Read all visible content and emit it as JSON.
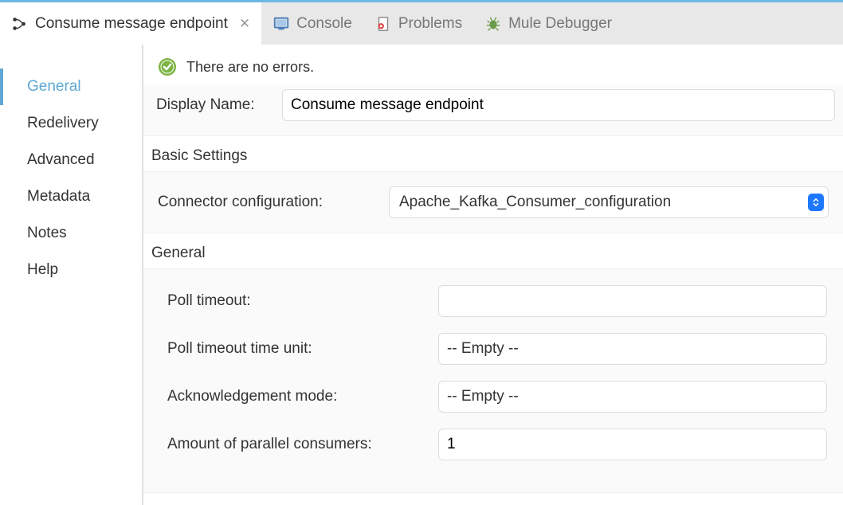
{
  "tabs": [
    {
      "label": "Consume message endpoint",
      "icon": "flow-icon",
      "active": true,
      "closable": true
    },
    {
      "label": "Console",
      "icon": "console-icon",
      "active": false,
      "closable": false
    },
    {
      "label": "Problems",
      "icon": "problems-icon",
      "active": false,
      "closable": false
    },
    {
      "label": "Mule Debugger",
      "icon": "debugger-icon",
      "active": false,
      "closable": false
    }
  ],
  "sidebar": {
    "items": [
      {
        "label": "General",
        "active": true
      },
      {
        "label": "Redelivery",
        "active": false
      },
      {
        "label": "Advanced",
        "active": false
      },
      {
        "label": "Metadata",
        "active": false
      },
      {
        "label": "Notes",
        "active": false
      },
      {
        "label": "Help",
        "active": false
      }
    ]
  },
  "status": {
    "message": "There are no errors."
  },
  "display_name": {
    "label": "Display Name:",
    "value": "Consume message endpoint"
  },
  "sections": {
    "basic": {
      "title": "Basic Settings",
      "connector_label": "Connector configuration:",
      "connector_value": "Apache_Kafka_Consumer_configuration"
    },
    "general": {
      "title": "General",
      "poll_timeout_label": "Poll timeout:",
      "poll_timeout_value": "",
      "poll_unit_label": "Poll timeout time unit:",
      "poll_unit_value": "-- Empty --",
      "ack_mode_label": "Acknowledgement mode:",
      "ack_mode_value": "-- Empty --",
      "parallel_label": "Amount of parallel consumers:",
      "parallel_value": "1"
    }
  }
}
